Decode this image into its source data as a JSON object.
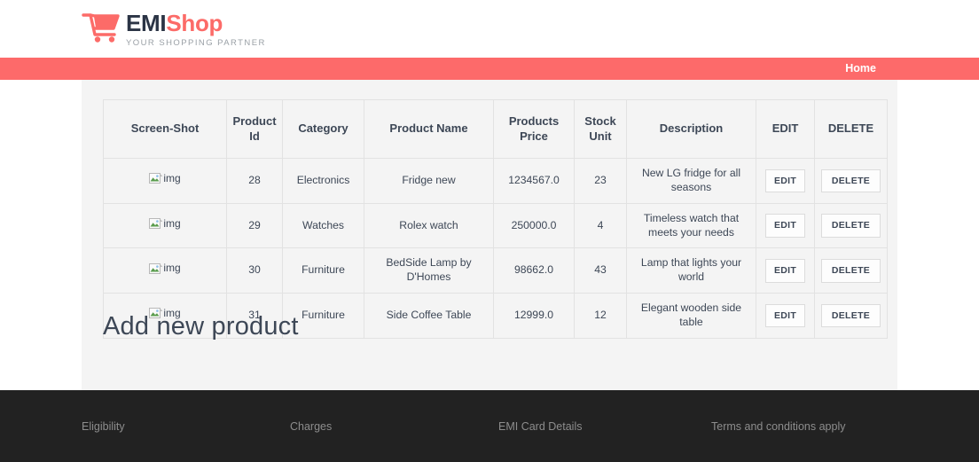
{
  "brand": {
    "icon": "shopping-cart-icon",
    "name_part1": "EMI",
    "name_part2": "Shop",
    "tagline": "YOUR SHOPPING PARTNER",
    "color_primary": "#2b3445",
    "color_accent": "#fc6b68"
  },
  "navbar": {
    "background": "#fd6a6a",
    "items": [
      {
        "label": "Home"
      }
    ]
  },
  "table": {
    "headers": [
      "Screen-Shot",
      "Product Id",
      "Category",
      "Product Name",
      "Products Price",
      "Stock Unit",
      "Description",
      "EDIT",
      "DELETE"
    ],
    "image_alt": "img",
    "rows": [
      {
        "screenshot": "img",
        "product_id": "28",
        "category": "Electronics",
        "product_name": "Fridge new",
        "price": "1234567.0",
        "stock_unit": "23",
        "description": "New LG fridge for all seasons",
        "edit_label": "EDIT",
        "delete_label": "DELETE"
      },
      {
        "screenshot": "img",
        "product_id": "29",
        "category": "Watches",
        "product_name": "Rolex watch",
        "price": "250000.0",
        "stock_unit": "4",
        "description": "Timeless watch that meets your needs",
        "edit_label": "EDIT",
        "delete_label": "DELETE"
      },
      {
        "screenshot": "img",
        "product_id": "30",
        "category": "Furniture",
        "product_name": "BedSide Lamp by D'Homes",
        "price": "98662.0",
        "stock_unit": "43",
        "description": "Lamp that lights your world",
        "edit_label": "EDIT",
        "delete_label": "DELETE"
      },
      {
        "screenshot": "img",
        "product_id": "31",
        "category": "Furniture",
        "product_name": "Side Coffee Table",
        "price": "12999.0",
        "stock_unit": "12",
        "description": "Elegant wooden side table",
        "edit_label": "EDIT",
        "delete_label": "DELETE"
      }
    ]
  },
  "main": {
    "add_product_heading": "Add new product"
  },
  "footer": {
    "background": "#222222",
    "links": [
      {
        "label": "Eligibility"
      },
      {
        "label": "Charges"
      },
      {
        "label": "EMI Card Details"
      },
      {
        "label": "Terms and conditions apply"
      }
    ]
  }
}
